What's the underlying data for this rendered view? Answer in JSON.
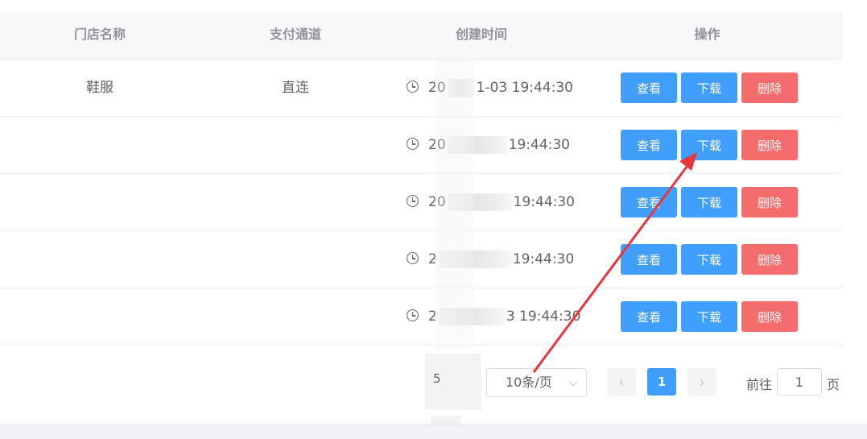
{
  "table": {
    "headers": {
      "store_name": "门店名称",
      "pay_channel": "支付通道",
      "created_time": "创建时间",
      "actions": "操作"
    },
    "rows": [
      {
        "store_name": "鞋服",
        "pay_channel": "直连",
        "time_prefix": "20",
        "time_suffix": "1-03 19:44:30"
      },
      {
        "store_name": "",
        "pay_channel": "",
        "time_prefix": "20",
        "time_suffix": "19:44:30"
      },
      {
        "store_name": "",
        "pay_channel": "",
        "time_prefix": "20",
        "time_suffix": "19:44:30"
      },
      {
        "store_name": "",
        "pay_channel": "",
        "time_prefix": "2",
        "time_suffix": "19:44:30"
      },
      {
        "store_name": "",
        "pay_channel": "",
        "time_prefix": "2",
        "time_suffix": "3 19:44:30"
      }
    ],
    "buttons": {
      "view": "查看",
      "download": "下载",
      "delete": "删除"
    }
  },
  "pagination": {
    "total_text": "5",
    "page_size": "10条/页",
    "prev_icon": "‹",
    "next_icon": "›",
    "current_page": "1",
    "goto_label": "前往",
    "goto_value": "1",
    "page_unit": "页"
  },
  "colors": {
    "primary": "#409eff",
    "danger": "#f56c6c",
    "annotation": "#e8363b"
  },
  "icons": {
    "time": "clock-icon",
    "prev": "chevron-left-icon",
    "next": "chevron-right-icon",
    "dropdown": "chevron-down-icon"
  }
}
